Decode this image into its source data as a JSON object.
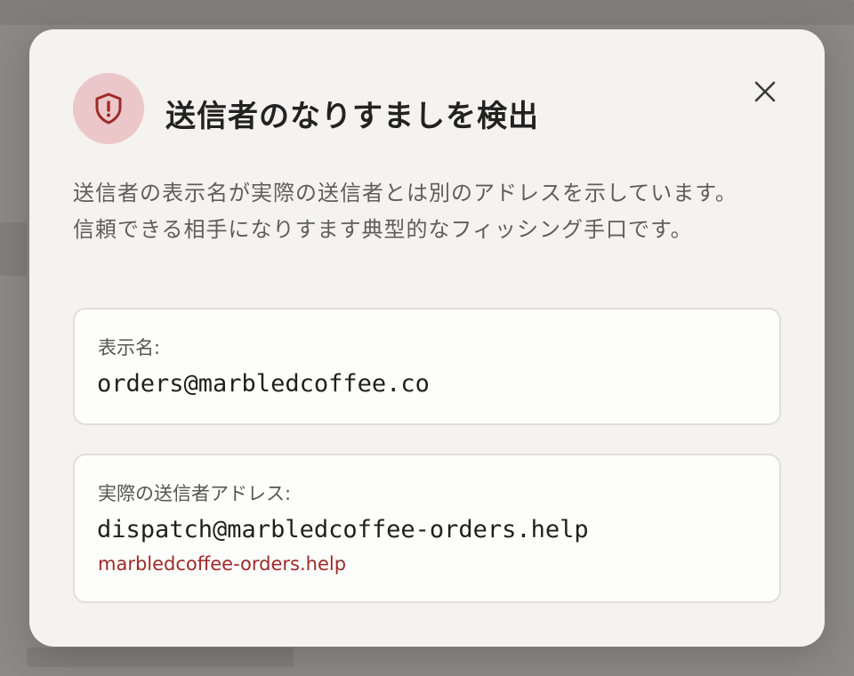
{
  "dialog": {
    "title": "送信者のなりすましを検出",
    "description": "送信者の表示名が実際の送信者とは別のアドレスを示しています。信頼できる相手になりすます典型的なフィッシング手口です。",
    "icon": "shield-warning-icon",
    "close_icon": "close-icon",
    "display_name": {
      "label": "表示名:",
      "value": "orders@marbledcoffee.co"
    },
    "actual_sender": {
      "label": "実際の送信者アドレス:",
      "value": "dispatch@marbledcoffee-orders.help",
      "domain": "marbledcoffee-orders.help"
    }
  },
  "colors": {
    "icon_circle_bg": "#ecc7c9",
    "icon_color": "#9e2a2a",
    "domain_highlight": "#9e2a2a",
    "dialog_bg": "#f4f3f0",
    "card_bg": "#fdfdfb",
    "overlay_bg": "#8c8b89"
  }
}
